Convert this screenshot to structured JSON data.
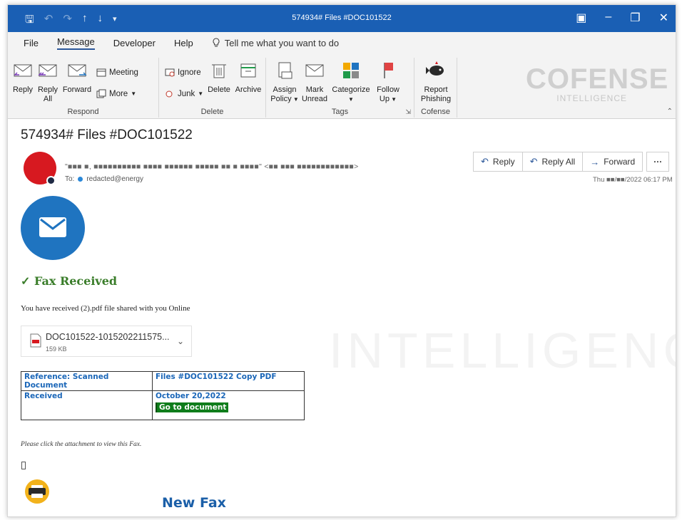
{
  "window": {
    "title": "574934# Files #DOC101522",
    "quick_access": [
      "save-icon",
      "undo-icon",
      "redo-icon",
      "up-icon",
      "down-icon",
      "customize-icon"
    ],
    "controls": [
      "ribbon-display-icon",
      "minimize-icon",
      "restore-icon",
      "close-icon"
    ]
  },
  "menu": {
    "tabs": [
      "File",
      "Message",
      "Developer",
      "Help"
    ],
    "active_tab": "Message",
    "tell_me": "Tell me what you want to do"
  },
  "ribbon": {
    "respond": {
      "label": "Respond",
      "reply": "Reply",
      "reply_all_1": "Reply",
      "reply_all_2": "All",
      "forward": "Forward",
      "meeting": "Meeting",
      "more": "More"
    },
    "delete": {
      "label": "Delete",
      "ignore": "Ignore",
      "junk": "Junk",
      "delete": "Delete",
      "archive": "Archive"
    },
    "tags": {
      "label": "Tags",
      "assign_1": "Assign",
      "assign_2": "Policy",
      "mark_1": "Mark",
      "mark_2": "Unread",
      "categorize": "Categorize",
      "follow_1": "Follow",
      "follow_2": "Up"
    },
    "cofense": {
      "label": "Cofense",
      "report_1": "Report",
      "report_2": "Phishing"
    },
    "brand": {
      "logo": "COFENSE",
      "subtitle": "INTELLIGENCE"
    }
  },
  "message": {
    "subject": "574934# Files #DOC101522",
    "sender_display": "\"■■■ ■, ■■■■■■■■■■ ■■■■ ■■■■■■ ■■■■■ ■■ ■ ■■■■\" <■■ ■■■ ■■■■■■■■■■■■>",
    "to_label": "To:",
    "to_value": "redacted@energy",
    "actions": {
      "reply": "Reply",
      "reply_all": "Reply All",
      "forward": "Forward",
      "more": "···"
    },
    "timestamp": "Thu ■■/■■/2022 06:17 PM"
  },
  "body": {
    "fax_received": "✓ Fax Received",
    "received_text": "You have received (2).pdf file shared with you Online",
    "attachment": {
      "name": "DOC101522-1015202211575...",
      "size": "159 KB"
    },
    "table": {
      "ref_label": "Reference: Scanned Document",
      "files": "Files #DOC101522 Copy PDF",
      "received_label": "Received",
      "date": "October 20,2022",
      "link": "Go to document"
    },
    "click_note": "Please click the attachment to view this Fax.",
    "new_fax": "New Fax",
    "watermark": "INTELLIGENCE"
  },
  "colors": {
    "titlebar": "#1a5fb4",
    "accent_blue": "#2b579a",
    "fax_green": "#3a7d2a",
    "link_green": "#0f7d1b",
    "avatar_red": "#d71920",
    "envelope_blue": "#1f74c0",
    "printer_yellow": "#f2b21b"
  }
}
